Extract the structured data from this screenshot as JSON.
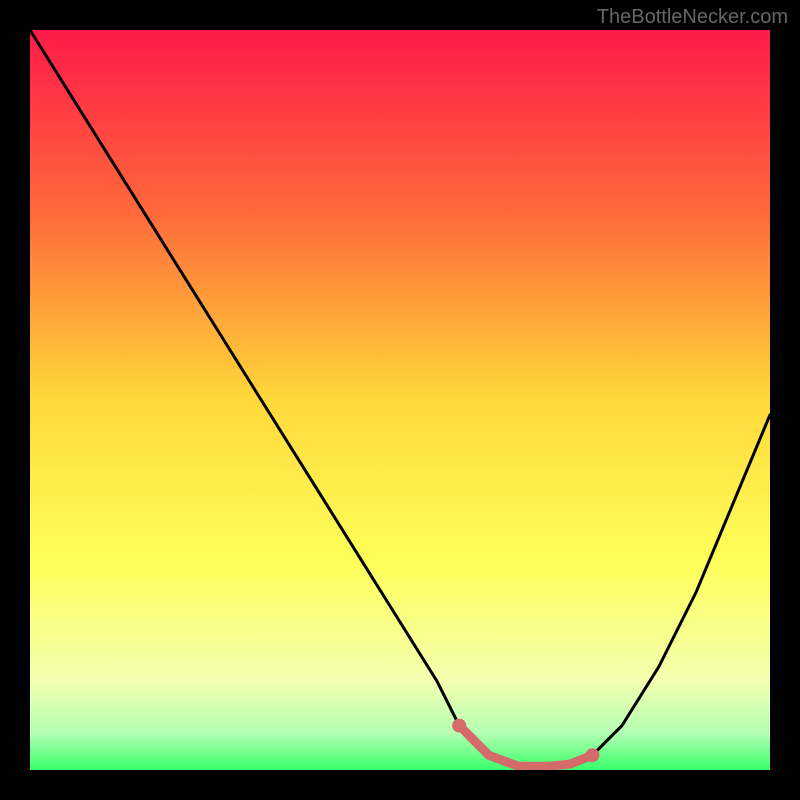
{
  "watermark": "TheBottleNecker.com",
  "chart_data": {
    "type": "line",
    "title": "",
    "xlabel": "",
    "ylabel": "",
    "xlim": [
      0,
      100
    ],
    "ylim": [
      0,
      100
    ],
    "background_gradient": {
      "top": "#ff1a4a",
      "mid1": "#ff6a3a",
      "mid2": "#ffd93a",
      "mid3": "#feff5a",
      "bottom": "#3aff6a"
    },
    "series": [
      {
        "name": "bottleneck-curve",
        "x": [
          0,
          5,
          10,
          15,
          20,
          25,
          30,
          35,
          40,
          45,
          50,
          55,
          58,
          62,
          66,
          70,
          73,
          76,
          80,
          85,
          90,
          95,
          100
        ],
        "y": [
          100,
          92,
          84,
          76,
          68,
          60,
          52,
          44,
          36,
          28,
          20,
          12,
          6,
          2,
          0.5,
          0.5,
          0.8,
          2,
          6,
          14,
          24,
          36,
          48
        ]
      }
    ],
    "highlight_segment": {
      "x": [
        58,
        62,
        66,
        70,
        73,
        76
      ],
      "y": [
        6,
        2,
        0.5,
        0.5,
        0.8,
        2
      ],
      "color": "#d46a6a"
    },
    "highlight_dots": [
      {
        "x": 58,
        "y": 6
      },
      {
        "x": 76,
        "y": 2
      }
    ]
  }
}
